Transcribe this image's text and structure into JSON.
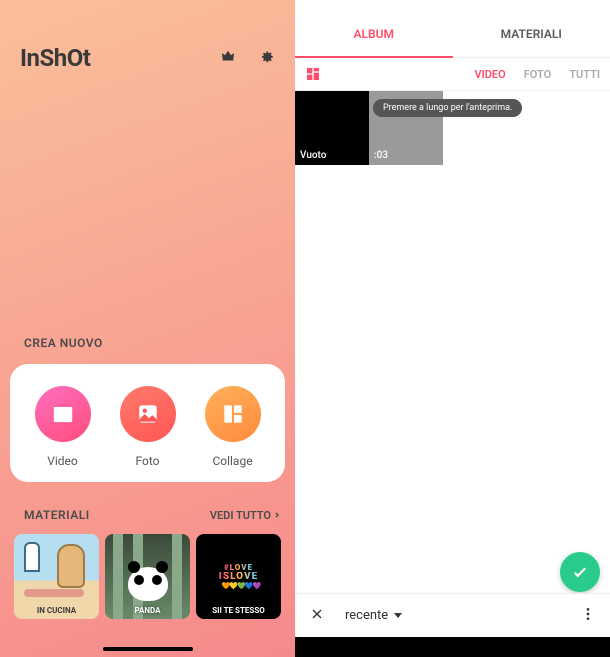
{
  "app": {
    "name": "InShOt"
  },
  "home": {
    "section_crea": "CREA NUOVO",
    "options": {
      "video": "Video",
      "foto": "Foto",
      "collage": "Collage"
    },
    "materiali_header": "MATERIALI",
    "vedi_tutto": "VEDI TUTTO",
    "materials": [
      {
        "caption": "IN CUCINA"
      },
      {
        "caption": "PANDA"
      },
      {
        "caption": "SII TE STESSO"
      }
    ],
    "love_text1": "#LOVE",
    "love_text2": "ISLOVE",
    "love_hearts": "❤🧡💛💚💙💜"
  },
  "picker": {
    "tabs": {
      "album": "ALBUM",
      "materiali": "MATERIALI"
    },
    "subtabs": {
      "video": "VIDEO",
      "foto": "FOTO",
      "tutti": "TUTTI"
    },
    "thumbs": [
      {
        "label": "Vuoto"
      },
      {
        "label": ":03"
      }
    ],
    "tooltip": "Premere a lungo per l'anteprima.",
    "recent_label": "recente"
  }
}
